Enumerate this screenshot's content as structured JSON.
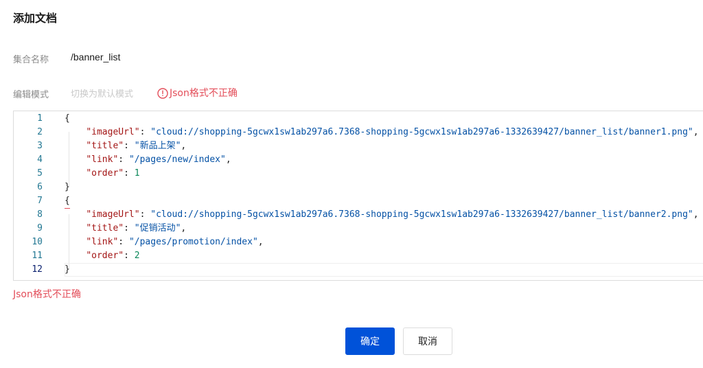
{
  "dialog": {
    "title": "添加文档",
    "collection_label": "集合名称",
    "collection_value": "/banner_list",
    "mode_label": "编辑模式",
    "switch_mode_label": "切换为默认模式",
    "inline_error": "Json格式不正确",
    "below_error": "Json格式不正确",
    "confirm_label": "确定",
    "cancel_label": "取消"
  },
  "editor": {
    "lines": [
      {
        "n": "1",
        "t": "{"
      },
      {
        "n": "2",
        "t": "    \"imageUrl\": \"cloud://shopping-5gcwx1sw1ab297a6.7368-shopping-5gcwx1sw1ab297a6-1332639427/banner_list/banner1.png\","
      },
      {
        "n": "3",
        "t": "    \"title\": \"新品上架\","
      },
      {
        "n": "4",
        "t": "    \"link\": \"/pages/new/index\","
      },
      {
        "n": "5",
        "t": "    \"order\": 1"
      },
      {
        "n": "6",
        "t": "}"
      },
      {
        "n": "7",
        "t": "{"
      },
      {
        "n": "8",
        "t": "    \"imageUrl\": \"cloud://shopping-5gcwx1sw1ab297a6.7368-shopping-5gcwx1sw1ab297a6-1332639427/banner_list/banner2.png\","
      },
      {
        "n": "9",
        "t": "    \"title\": \"促销活动\","
      },
      {
        "n": "10",
        "t": "    \"link\": \"/pages/promotion/index\","
      },
      {
        "n": "11",
        "t": "    \"order\": 2"
      },
      {
        "n": "12",
        "t": "}"
      }
    ],
    "active_line": 12,
    "error_line": 7
  },
  "colors": {
    "primary": "#0052d9",
    "error": "#e34d59",
    "json_key": "#a31515",
    "json_string": "#0451a5",
    "json_number": "#098658",
    "line_number": "#237893"
  },
  "icons": {
    "error": "error-circle-icon"
  }
}
